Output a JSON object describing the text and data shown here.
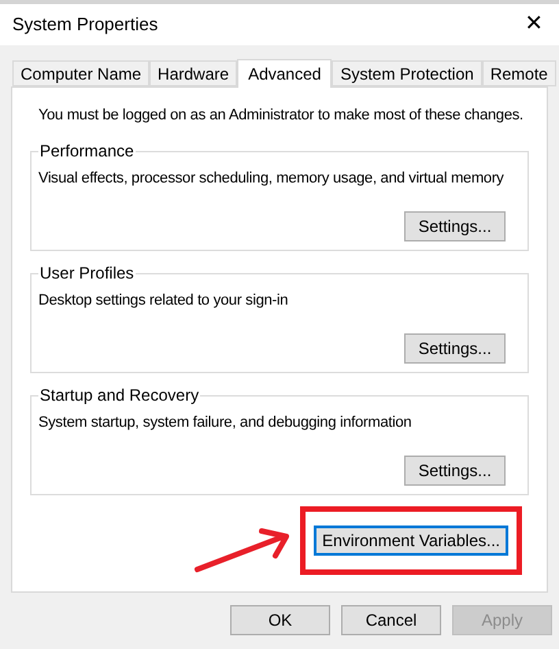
{
  "window": {
    "title": "System Properties",
    "close": "✕"
  },
  "tabs": [
    {
      "label": "Computer Name",
      "selected": false
    },
    {
      "label": "Hardware",
      "selected": false
    },
    {
      "label": "Advanced",
      "selected": true
    },
    {
      "label": "System Protection",
      "selected": false
    },
    {
      "label": "Remote",
      "selected": false
    }
  ],
  "notice": "You must be logged on as an Administrator to make most of these changes.",
  "groups": [
    {
      "title": "Performance",
      "description": "Visual effects, processor scheduling, memory usage, and virtual memory",
      "button": "Settings..."
    },
    {
      "title": "User Profiles",
      "description": "Desktop settings related to your sign-in",
      "button": "Settings..."
    },
    {
      "title": "Startup and Recovery",
      "description": "System startup, system failure, and debugging information",
      "button": "Settings..."
    }
  ],
  "env_button": {
    "label": "Environment Variables...",
    "focused": true
  },
  "buttons": [
    {
      "label": "OK",
      "disabled": false
    },
    {
      "label": "Cancel",
      "disabled": false
    },
    {
      "label": "Apply",
      "disabled": true
    }
  ]
}
